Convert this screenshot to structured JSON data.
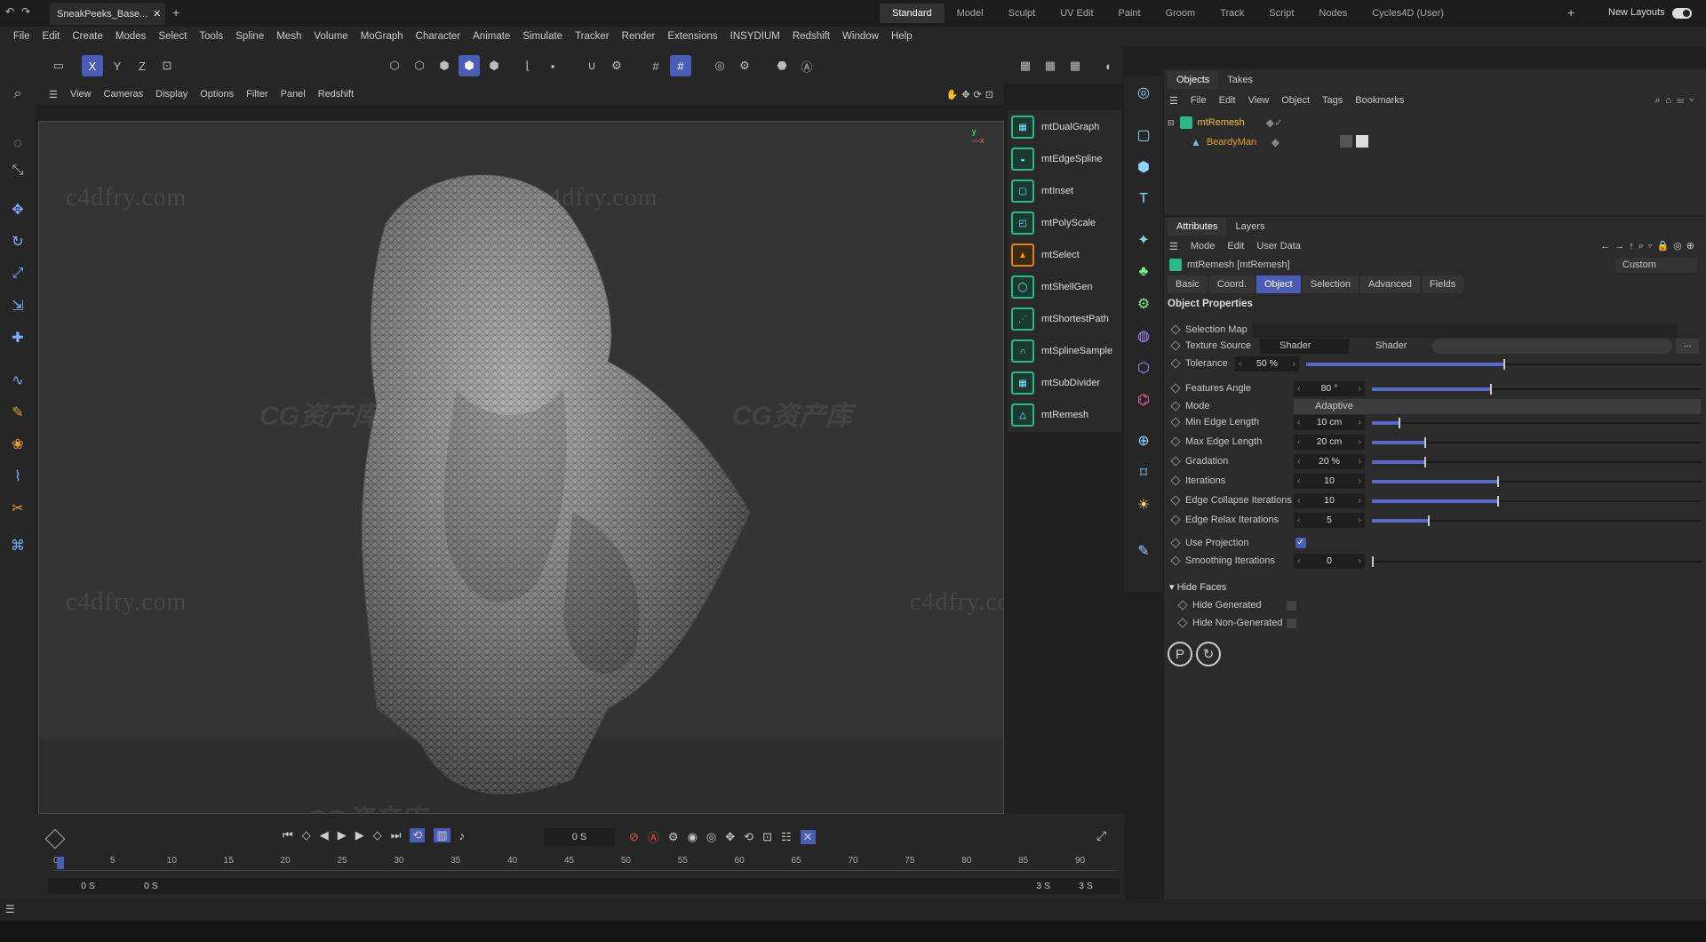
{
  "title_tab": "SneakPeeks_Base...",
  "layouts": [
    "Standard",
    "Model",
    "Sculpt",
    "UV Edit",
    "Paint",
    "Groom",
    "Track",
    "Script",
    "Nodes",
    "Cycles4D (User)"
  ],
  "new_layouts": "New Layouts",
  "menu": [
    "File",
    "Edit",
    "Create",
    "Modes",
    "Select",
    "Tools",
    "Spline",
    "Mesh",
    "Volume",
    "MoGraph",
    "Character",
    "Animate",
    "Simulate",
    "Tracker",
    "Render",
    "Extensions",
    "INSYDIUM",
    "Redshift",
    "Window",
    "Help"
  ],
  "axis": {
    "x": "X",
    "y": "Y",
    "z": "Z"
  },
  "viewport_menu": [
    "View",
    "Cameras",
    "Display",
    "Options",
    "Filter",
    "Panel",
    "Redshift"
  ],
  "watermark_text": "c4dfry.com",
  "watermark_cg": "CG资产库",
  "plugins": [
    "mtDualGraph",
    "mtEdgeSpline",
    "mtInset",
    "mtPolyScale",
    "mtSelect",
    "mtShellGen",
    "mtShortestPath",
    "mtSplineSample",
    "mtSubDivider",
    "mtRemesh"
  ],
  "objects_panel": {
    "tabs": [
      "Objects",
      "Takes"
    ],
    "menu": [
      "File",
      "Edit",
      "View",
      "Object",
      "Tags",
      "Bookmarks"
    ],
    "items": [
      {
        "name": "mtRemesh",
        "color": "#f0c040"
      },
      {
        "name": "BeardyMan",
        "color": "#e0a030"
      }
    ]
  },
  "attributes_panel": {
    "tabs": [
      "Attributes",
      "Layers"
    ],
    "menu": [
      "Mode",
      "Edit",
      "User Data"
    ],
    "object_name": "mtRemesh [mtRemesh]",
    "preset": "Custom",
    "subtabs": [
      "Basic",
      "Coord.",
      "Object",
      "Selection",
      "Advanced",
      "Fields"
    ],
    "active_subtab": "Object",
    "section": "Object Properties",
    "selection_map": "Selection Map",
    "texture_source_label": "Texture Source",
    "texture_source_value": "Shader",
    "shader_label": "Shader",
    "shader_btn": "...",
    "tolerance_label": "Tolerance",
    "tolerance_value": "50 %",
    "tolerance_fraction": 0.5,
    "features_angle_label": "Features Angle",
    "features_angle_value": "80 °",
    "mode_label": "Mode",
    "mode_value": "Adaptive",
    "sliders": [
      {
        "label": "Min Edge Length",
        "value": "10 cm",
        "fraction": 0.08
      },
      {
        "label": "Max Edge Length",
        "value": "20 cm",
        "fraction": 0.16
      },
      {
        "label": "Gradation",
        "value": "20 %",
        "fraction": 0.16
      },
      {
        "label": "Iterations",
        "value": "10",
        "fraction": 0.38
      },
      {
        "label": "Edge Collapse Iterations",
        "value": "10",
        "fraction": 0.38
      },
      {
        "label": "Edge Relax Iterations",
        "value": "5",
        "fraction": 0.17
      }
    ],
    "use_projection_label": "Use Projection",
    "use_projection_checked": true,
    "smoothing_label": "Smoothing Iterations",
    "smoothing_value": "0",
    "hide_faces_label": "Hide Faces",
    "hide_generated": "Hide Generated",
    "hide_non_generated": "Hide Non-Generated"
  },
  "timeline": {
    "current_time": "0 S",
    "ticks": [
      "0",
      "5",
      "10",
      "15",
      "20",
      "25",
      "30",
      "35",
      "40",
      "45",
      "50",
      "55",
      "60",
      "65",
      "70",
      "75",
      "80",
      "85",
      "90"
    ],
    "start": "0 S",
    "range_start": "0 S",
    "range_end": "3 S",
    "end": "3 S"
  },
  "colors": {
    "accent": "#4a5db5",
    "plugin": "#2cb88a"
  }
}
